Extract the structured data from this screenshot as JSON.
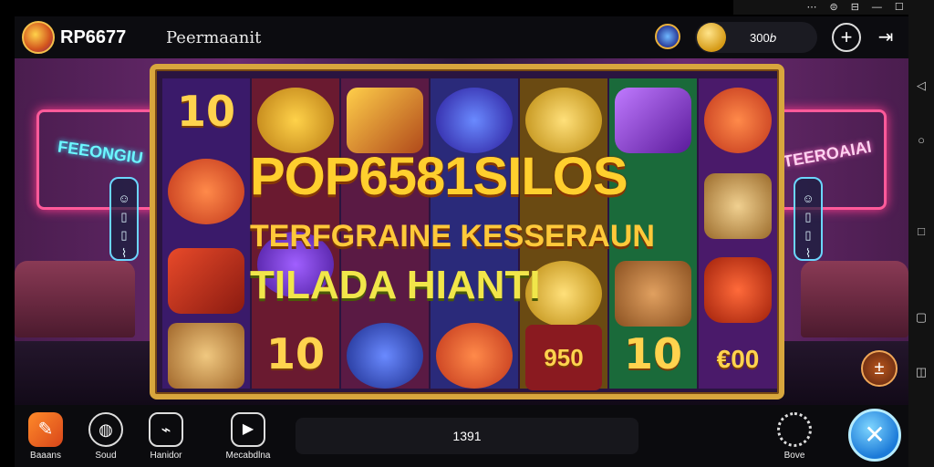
{
  "emulator": {
    "top_icons": [
      "⋯",
      "⊜",
      "⊟",
      "—",
      "☐",
      "✕"
    ],
    "side_icons": [
      "◁",
      "○",
      "□",
      "▢",
      "◫"
    ]
  },
  "header": {
    "brand": "RP6677",
    "title": "Peermaanit",
    "coin_value": "300𝑏",
    "plus_icon": "+",
    "menu_icon": "⇥"
  },
  "scene": {
    "sign_left": "FEEONGIU",
    "sign_right": "TEEROAIAI",
    "side_left": "☺\n▯\n▯\n⌇",
    "side_right": "☺\n▯\n▯\n⌇",
    "corner_icon": "±"
  },
  "reels": [
    [
      "10",
      "●",
      "◆",
      "◉"
    ],
    [
      "●",
      "⬤",
      "🥖",
      "10"
    ],
    [
      "🪵",
      "⬢",
      "●",
      "◉"
    ],
    [
      "●",
      "●",
      "⬢",
      "●"
    ],
    [
      "●",
      "◙",
      "◎",
      "950"
    ],
    [
      "⬮",
      "⬭",
      "◈",
      "10"
    ],
    [
      "●",
      "◆",
      "⬮",
      "€00"
    ]
  ],
  "headline": {
    "line1": "POP6581SILOS",
    "line2": "TERFGRAINE KESSERAUN",
    "line3": "TILADA HIANTI"
  },
  "bottom": {
    "buttons": [
      {
        "label": "Baaans",
        "icon": "✎"
      },
      {
        "label": "Soud",
        "icon": "◍"
      },
      {
        "label": "Hanidor",
        "icon": "⌁"
      },
      {
        "label": "Mecabdlna",
        "icon": "▶"
      }
    ],
    "info_value": "1391",
    "settings_label": "Bove",
    "spin_icon": "✕"
  },
  "colors": {
    "frame": "#d8a63d",
    "gold_text": "#ffd34e",
    "spin": "#1b7ad8",
    "neon_pink": "#ff5a9a"
  }
}
